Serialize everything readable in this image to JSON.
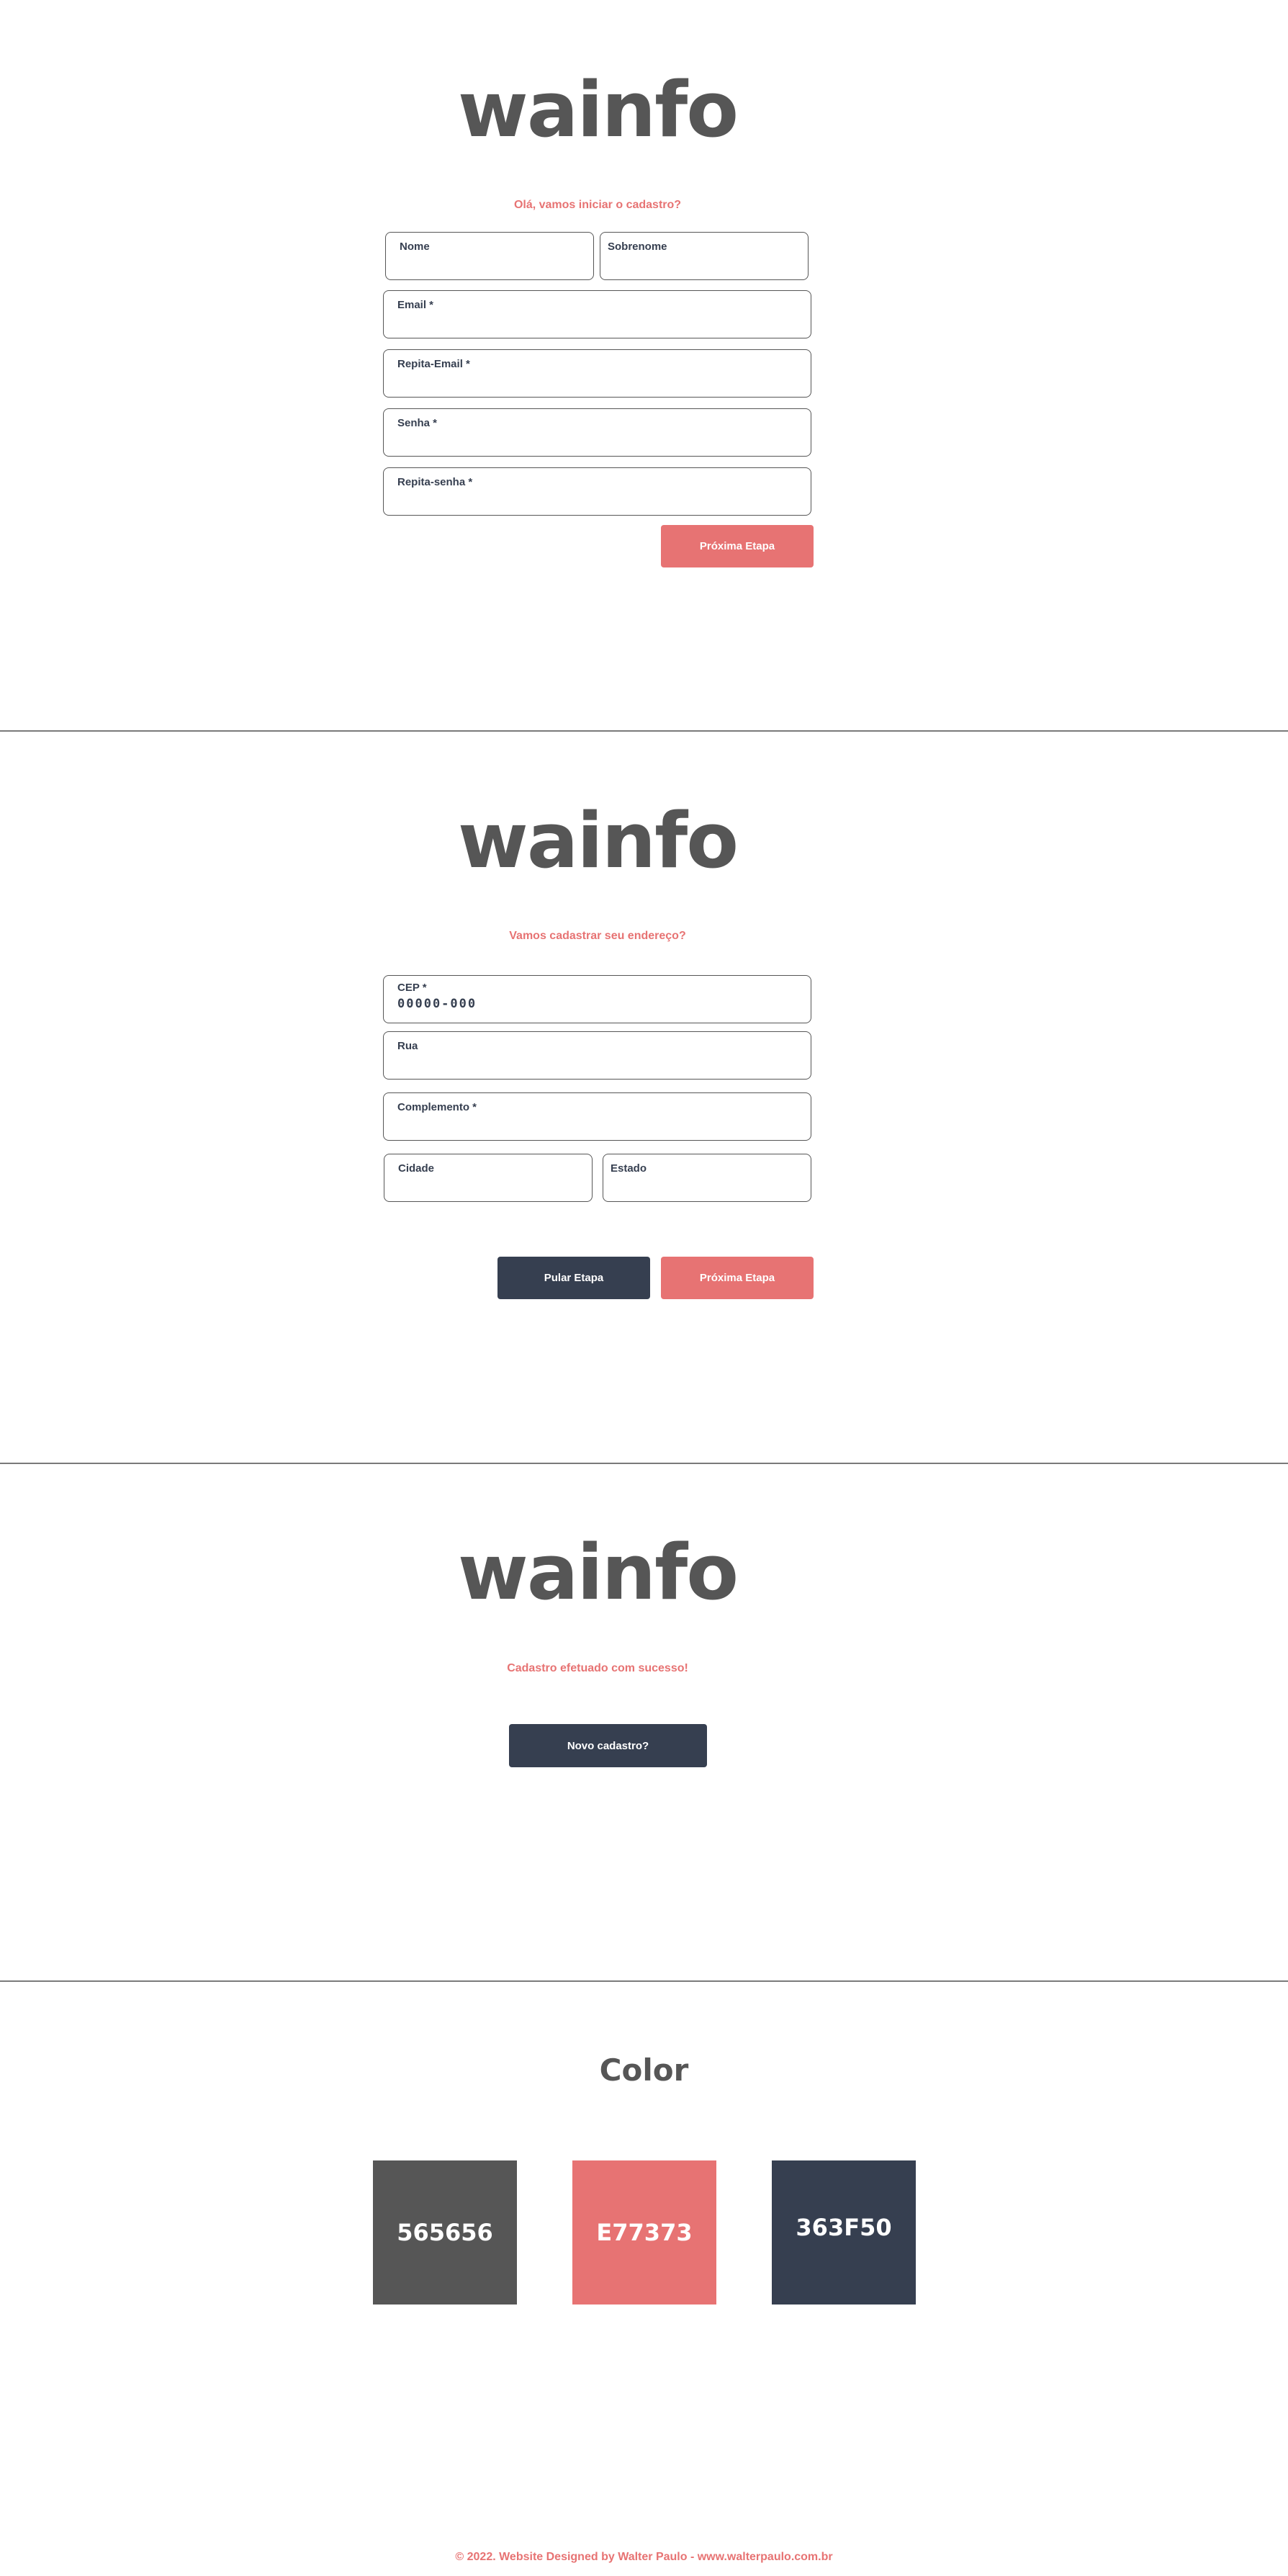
{
  "screen1": {
    "logo": "wainfo",
    "subtitle": "Olá, vamos iniciar o cadastro?",
    "fields": {
      "nome": "Nome",
      "sobrenome": "Sobrenome",
      "email": "Email *",
      "repita_email": "Repita-Email *",
      "senha": "Senha *",
      "repita_senha": "Repita-senha *"
    },
    "next_button": "Próxima Etapa"
  },
  "screen2": {
    "logo": "wainfo",
    "subtitle": "Vamos cadastrar seu endereço?",
    "fields": {
      "cep_label": "CEP *",
      "cep_value": "00000-000",
      "rua": "Rua",
      "complemento": "Complemento *",
      "cidade": "Cidade",
      "estado": "Estado"
    },
    "skip_button": "Pular Etapa",
    "next_button": "Próxima Etapa"
  },
  "screen3": {
    "logo": "wainfo",
    "subtitle": "Cadastro efetuado com sucesso!",
    "new_button": "Novo cadastro?"
  },
  "palette": {
    "title": "Color",
    "swatches": [
      {
        "label": "565656",
        "color": "#565656"
      },
      {
        "label": "E77373",
        "color": "#E77373"
      },
      {
        "label": "363F50",
        "color": "#363F50"
      }
    ]
  },
  "footer": "© 2022. Website Designed by Walter Paulo - www.walterpaulo.com.br"
}
